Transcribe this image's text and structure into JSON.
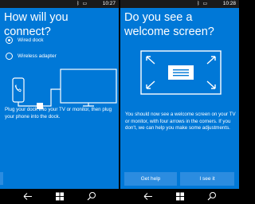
{
  "colors": {
    "background": "#0078d7",
    "button": "#2b8ce0",
    "status_bar": "#1a1a1a",
    "nav_bar": "#000000",
    "foreground": "#ffffff"
  },
  "left_screen": {
    "status": {
      "time": "10:27",
      "icons": [
        "bluetooth-icon",
        "battery-icon"
      ]
    },
    "title": "How will you connect?",
    "options": [
      {
        "label": "Wired dock",
        "selected": true
      },
      {
        "label": "Wireless adapter",
        "selected": false
      }
    ],
    "illustration": "phone-to-dock-to-monitor",
    "instruction": "Plug your dock into your TV or monitor, then plug your phone into the dock."
  },
  "right_screen": {
    "status": {
      "time": "10:28",
      "icons": [
        "bluetooth-icon",
        "battery-icon"
      ]
    },
    "title": "Do you see a welcome screen?",
    "illustration": "monitor-with-corner-arrows",
    "instruction": "You should now see a welcome screen on your TV or monitor, with four arrows in the corners. If you don't, we can help you make some adjustments.",
    "buttons": {
      "get_help": "Get help",
      "i_see_it": "I see it"
    }
  },
  "nav_bar": {
    "icons": [
      "back-icon",
      "windows-start-icon",
      "search-icon"
    ]
  }
}
